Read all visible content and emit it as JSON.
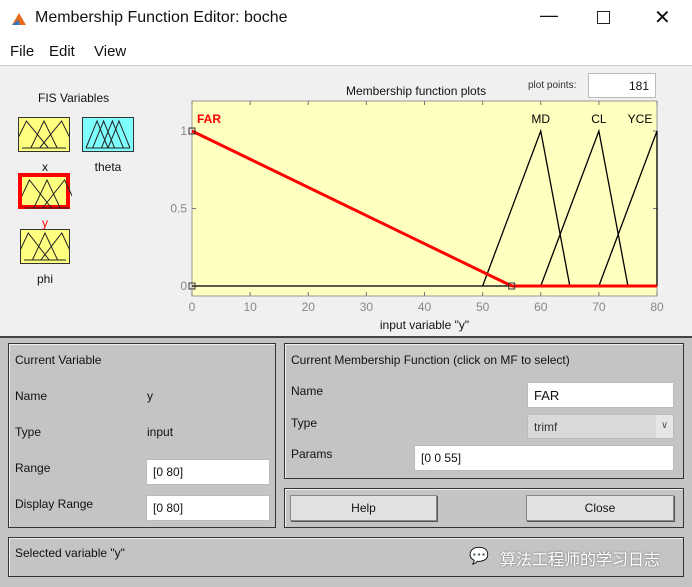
{
  "window": {
    "title": "Membership Function Editor: boche",
    "minimize_icon": "minimize-icon",
    "maximize_icon": "maximize-icon",
    "close_icon": "close-icon"
  },
  "menu": [
    "File",
    "Edit",
    "View"
  ],
  "fis": {
    "heading": "FIS Variables",
    "variables": [
      {
        "name": "x",
        "color": "#ffff80"
      },
      {
        "name": "theta",
        "color": "#80ffff"
      },
      {
        "name": "y",
        "color": "#ffff80",
        "selected": true
      },
      {
        "name": "phi",
        "color": "#ffff80"
      }
    ]
  },
  "plot": {
    "plot_points_label": "plot points:",
    "plot_points": "181"
  },
  "chart_data": {
    "type": "line",
    "title": "Membership function plots",
    "xlabel": "input variable \"y\"",
    "ylabel": "",
    "xlim": [
      0,
      80
    ],
    "ylim": [
      0,
      1.2
    ],
    "xticks": [
      "0",
      "10",
      "20",
      "30",
      "40",
      "50",
      "60",
      "70",
      "80"
    ],
    "yticks": [
      "0",
      "0.5",
      "1"
    ],
    "background": "#ffffc0",
    "series": [
      {
        "name": "FAR",
        "points": [
          [
            0,
            1
          ],
          [
            0,
            1
          ],
          [
            55,
            0
          ]
        ],
        "selected": true,
        "color": "#ff0000"
      },
      {
        "name": "MD",
        "points": [
          [
            50,
            0
          ],
          [
            60,
            1
          ],
          [
            65,
            0
          ]
        ],
        "color": "#000000"
      },
      {
        "name": "CL",
        "points": [
          [
            60,
            0
          ],
          [
            70,
            1
          ],
          [
            75,
            0
          ]
        ],
        "color": "#000000"
      },
      {
        "name": "YCE",
        "points": [
          [
            70,
            0
          ],
          [
            80,
            1
          ],
          [
            80,
            0
          ]
        ],
        "color": "#000000"
      }
    ]
  },
  "current_variable": {
    "heading": "Current Variable",
    "name_label": "Name",
    "name": "y",
    "type_label": "Type",
    "type": "input",
    "range_label": "Range",
    "range": "[0 80]",
    "display_range_label": "Display Range",
    "display_range": "[0 80]"
  },
  "current_mf": {
    "heading": "Current Membership Function (click on MF to select)",
    "name_label": "Name",
    "name": "FAR",
    "type_label": "Type",
    "type": "trimf",
    "params_label": "Params",
    "params": "[0 0 55]"
  },
  "buttons": {
    "help": "Help",
    "close": "Close"
  },
  "status": "Selected variable \"y\"",
  "watermark": "算法工程师的学习日志"
}
